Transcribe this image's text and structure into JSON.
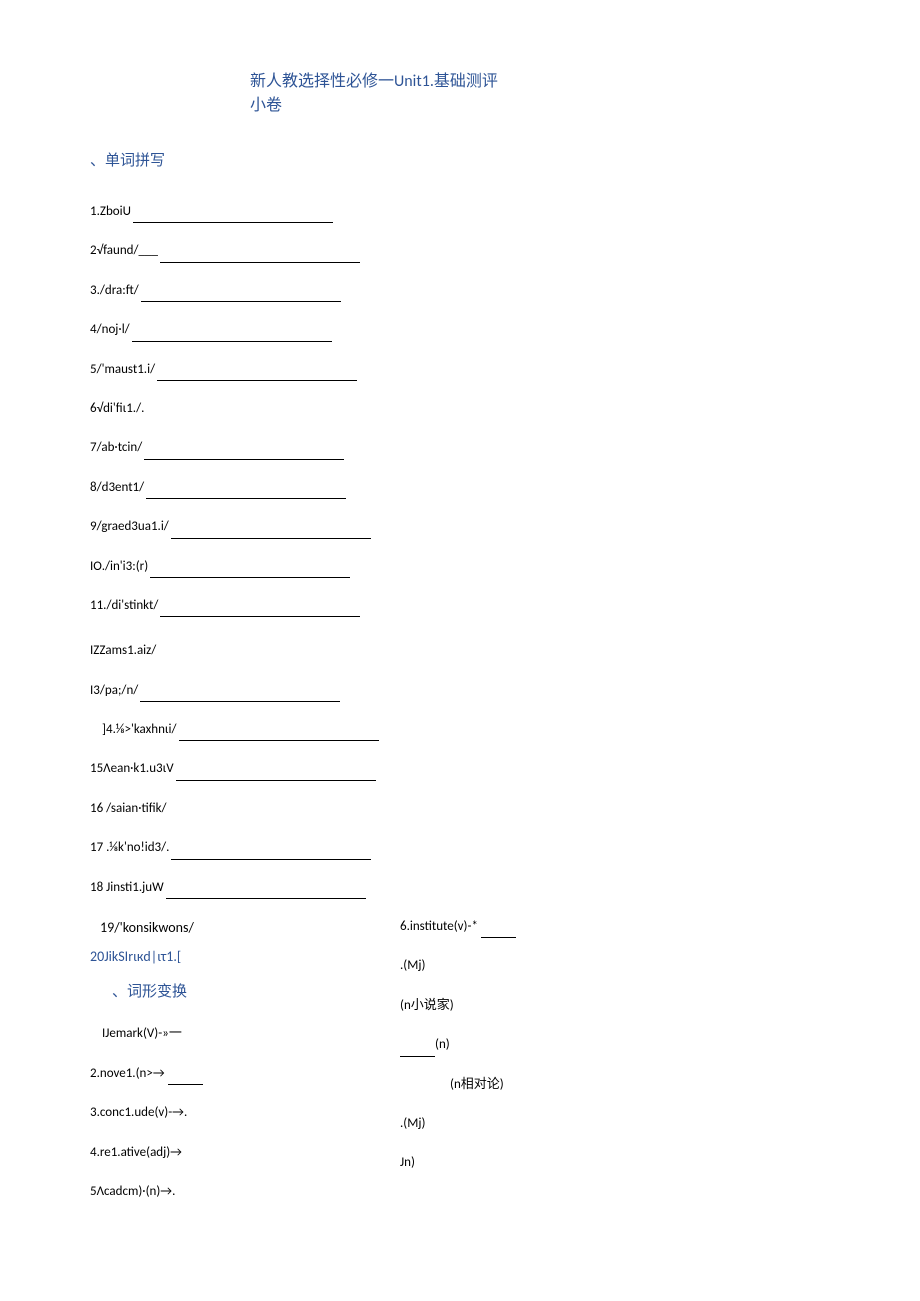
{
  "header": {
    "line1": "新人教选择性必修一Unit1.基础测评",
    "line2": "小卷"
  },
  "section1": {
    "heading": "、单词拼写",
    "items": [
      "1.ZboiU",
      "2√faund/___",
      "3./dra:ft/",
      "4/noj·l/",
      "5/'maust1.i/",
      "6√di'fiι1./.",
      "7/ab·tcin/",
      "8/d3ent1/",
      "9/graed3ua1.i/",
      "IO./in'i3:(r)",
      "11./di'stinkt/",
      "IZZams1.aiz/",
      "I3/pa;/n/",
      "]4.⅛>'kaxhnιi/",
      "15Λean·k1.u3ιV",
      "16   /saian·tifik/",
      "17   .⅛k'no!id3/.",
      "18   Jinsti1.juW"
    ],
    "item19": "19/'konsikwons/",
    "item20": "20JikSIrιкd|ιτ1.["
  },
  "section2": {
    "heading": "、词形变换",
    "left_items": [
      "IJemark(V)-»一",
      "2.nove1.(n>→",
      "3.conc1.ude(v)-→.",
      "4.re1.ative(adj)→",
      "5Λcadcm)·(n)→."
    ],
    "right_items": [
      "6.institute(v)-*",
      ".(Mj)",
      "(n小说家)",
      "(n)",
      "(n相对论)",
      ".(Mj)",
      "Jn)"
    ]
  }
}
